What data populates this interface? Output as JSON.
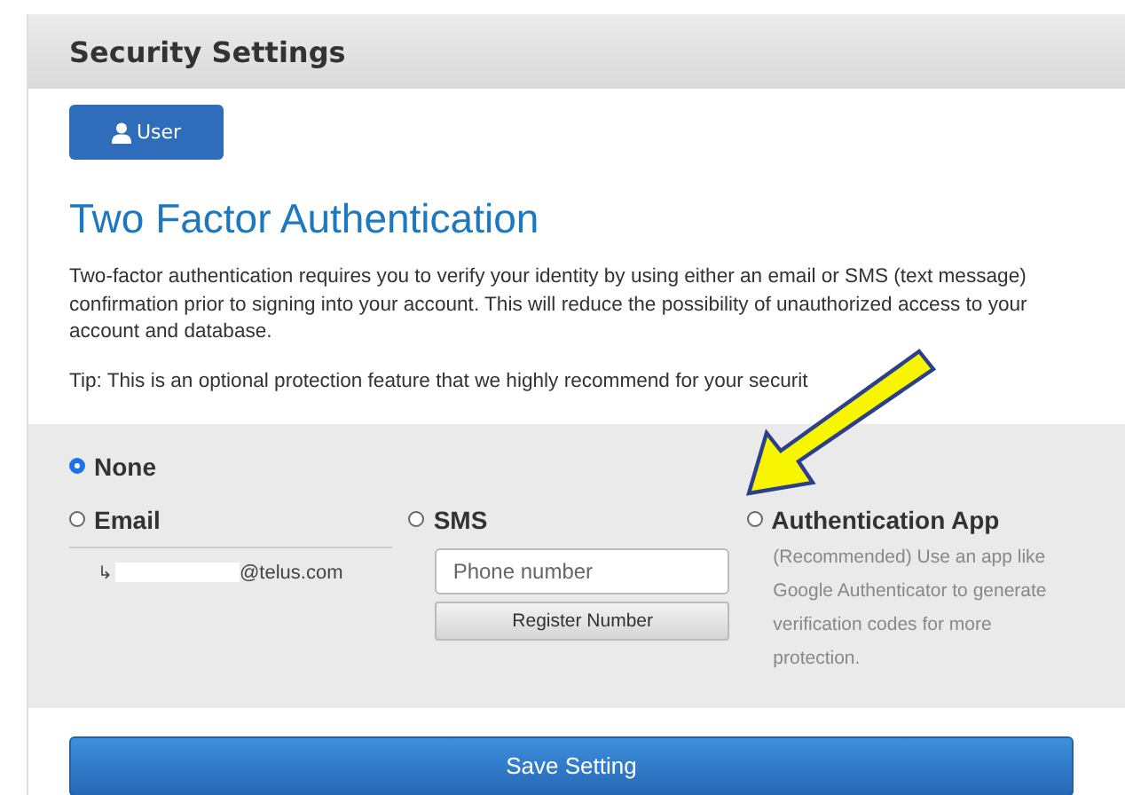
{
  "panel": {
    "title": "Security Settings"
  },
  "user_button": {
    "label": "User"
  },
  "heading": "Two Factor Authentication",
  "description": "Two-factor authentication requires you to verify your identity by using either an email or SMS (text message) confirmation prior to signing into your account. This will reduce the possibility of unauthorized access to your account and database.",
  "tip": "Tip: This is an optional protection feature that we highly recommend for your securit",
  "options": [
    {
      "kind": "plain",
      "label": "None",
      "selected": true
    },
    {
      "kind": "email",
      "label": "Email",
      "selected": false,
      "marker": "↳",
      "address": "@telus.com"
    },
    {
      "kind": "sms",
      "label": "SMS",
      "selected": false,
      "placeholder": "Phone number",
      "button": "Register Number"
    },
    {
      "kind": "app",
      "label": "Authentication App",
      "selected": false,
      "note": "(Recommended) Use an app like Google Authenticator to generate verification codes for more protection."
    }
  ],
  "save_button": "Save Setting"
}
